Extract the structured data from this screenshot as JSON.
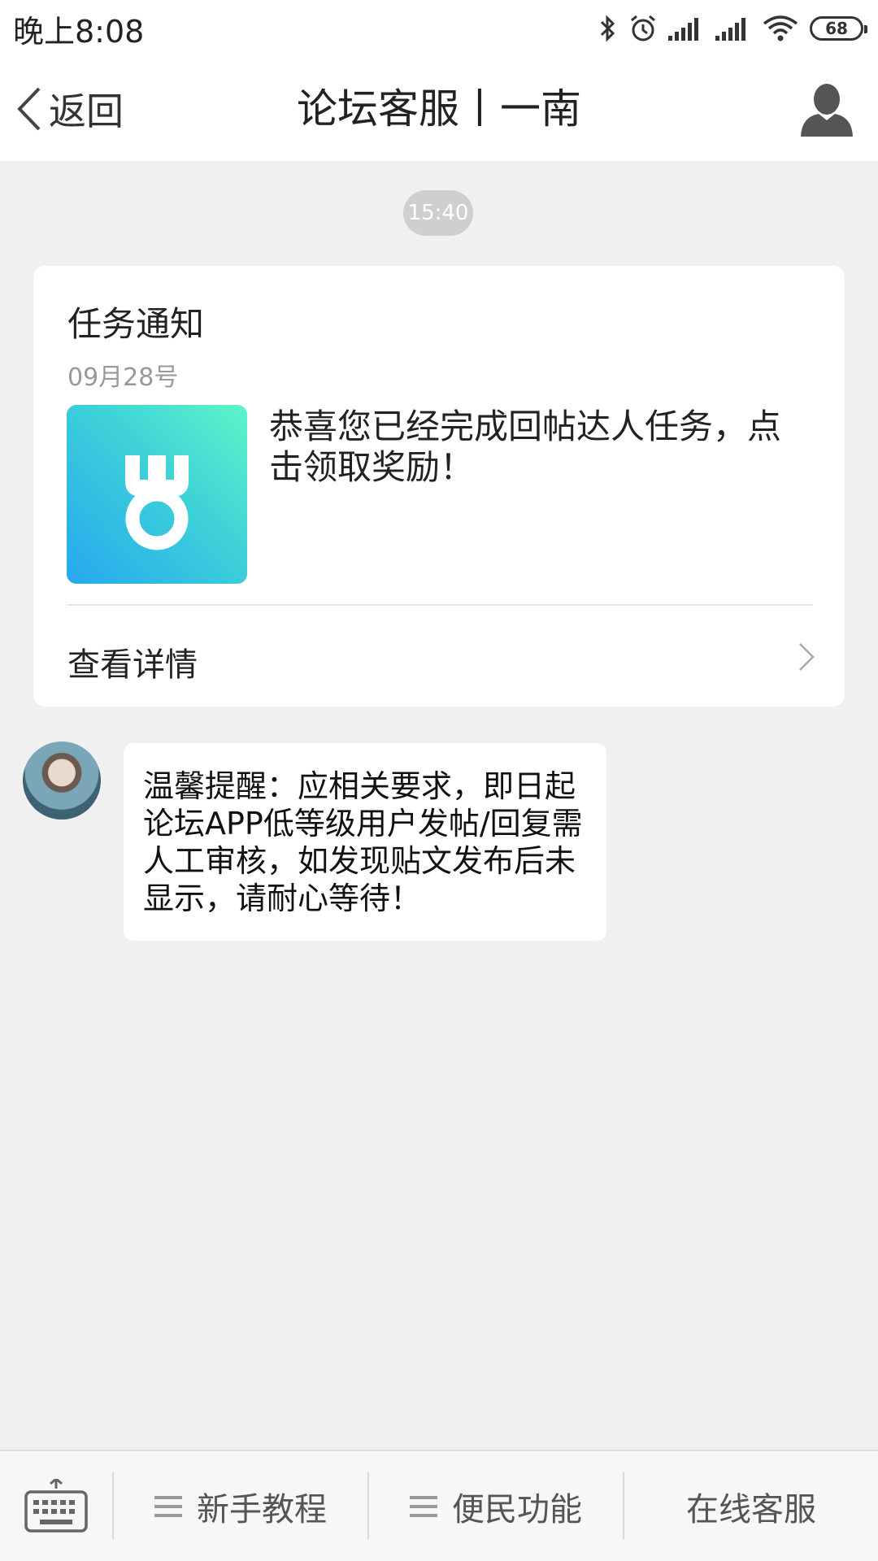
{
  "status_bar": {
    "time": "晚上8:08",
    "battery": "68",
    "icons": [
      "bluetooth-icon",
      "alarm-icon",
      "signal-icon",
      "signal-icon",
      "wifi-icon",
      "battery-icon"
    ]
  },
  "header": {
    "back_label": "返回",
    "title": "论坛客服丨一南",
    "profile_icon": "person-icon"
  },
  "chat": {
    "timestamp": "15:40",
    "notice_card": {
      "title": "任务通知",
      "date": "09月28号",
      "image_icon": "medal-icon",
      "message": "恭喜您已经完成回帖达人任务，点击领取奖励！",
      "detail_label": "查看详情"
    },
    "message": {
      "avatar": "avatar",
      "text": "温馨提醒：应相关要求，即日起论坛APP低等级用户发帖/回复需人工审核，如发现贴文发布后未显示，请耐心等待！"
    }
  },
  "bottom_bar": {
    "keyboard_icon": "keyboard-icon",
    "tabs": [
      {
        "label": "新手教程",
        "icon": "menu-lines-icon"
      },
      {
        "label": "便民功能",
        "icon": "menu-lines-icon"
      },
      {
        "label": "在线客服"
      }
    ]
  },
  "colors": {
    "background": "#f0f0f0",
    "card": "#ffffff",
    "medal_gradient_start": "#26a8f0",
    "medal_gradient_end": "#5ef5c8"
  }
}
